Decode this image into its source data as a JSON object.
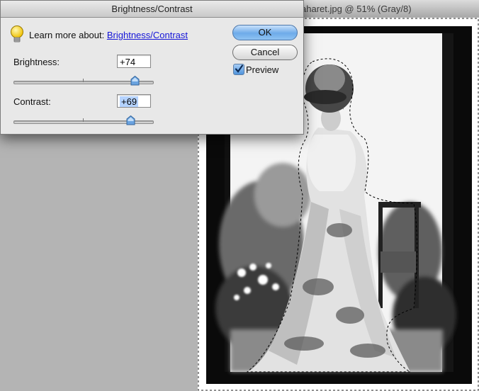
{
  "document": {
    "title_fragment": "aharet.jpg @ 51% (Gray/8)"
  },
  "dialog": {
    "title": "Brightness/Contrast",
    "learn_prefix": "Learn more about: ",
    "learn_link": "Brightness/Contrast",
    "brightness_label": "Brightness:",
    "brightness_value": "+74",
    "contrast_label": "Contrast:",
    "contrast_value": "+69",
    "ok_label": "OK",
    "cancel_label": "Cancel",
    "preview_label": "Preview",
    "preview_checked": true,
    "brightness_slider_fraction": 0.87,
    "contrast_slider_fraction": 0.84
  },
  "colors": {
    "ok_button": "#6eabe9",
    "link": "#1515d8",
    "checkbox": "#4f93db"
  },
  "icons": {
    "help": "lightbulb-icon",
    "slider_thumb": "triangle-thumb-icon",
    "checkbox": "checkmark-icon"
  }
}
